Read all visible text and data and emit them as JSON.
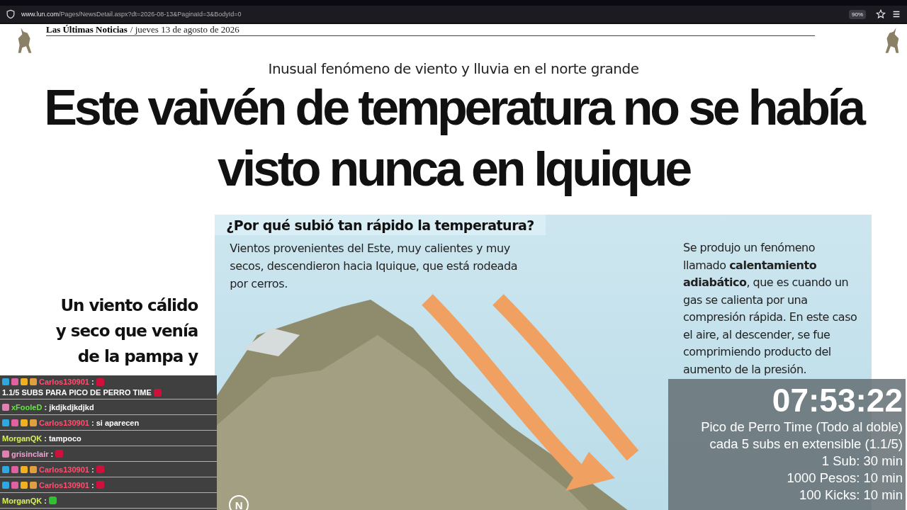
{
  "browser": {
    "url_host": "www.lun.com",
    "url_path": "/Pages/NewsDetail.aspx?dt=2026-08-13&PaginaId=3&BodyId=0",
    "zoom": "90%"
  },
  "newspaper": {
    "name": "Las Últimas Noticias",
    "date": "/ jueves 13 de agosto de 2026"
  },
  "article": {
    "kicker": "Inusual fenómeno de viento y lluvia en el norte grande",
    "headline": [
      "Este vaivén de temperatura no se había",
      "visto nunca en Iquique"
    ],
    "lead": [
      "Un viento cálido",
      "y seco que venía",
      "de la pampa y"
    ],
    "infographic": {
      "title": "¿Por qué subió tan rápido la temperatura?",
      "left_text": "Vientos provenientes del Este, muy calientes y muy secos, descendieron hacia Iquique, que está rodeada por cerros.",
      "right_text": "Se produjo un fenómeno llamado **calentamiento adiabático**, que es cuando un gas se calienta por una compresión rápida. En este caso el aire, al descender, se fue comprimiendo producto del aumento de la presión.",
      "compass": "N"
    }
  },
  "chat": [
    {
      "kind": "full",
      "user": "Carlos130901",
      "color": "#ff5070",
      "parts": [
        {
          "kind": "text",
          "text": ":"
        },
        {
          "kind": "emote",
          "color": "#d0103a"
        },
        {
          "kind": "text",
          "text": "1.1/5 SUBS PARA PICO DE PERRO TIME"
        },
        {
          "kind": "emote",
          "color": "#d0103a"
        }
      ]
    },
    {
      "kind": "sub",
      "user": "xFooleD",
      "color": "#5fe83a",
      "parts": [
        {
          "kind": "text",
          "text": ": jkdjkdjkdjkd"
        }
      ]
    },
    {
      "kind": "full",
      "user": "Carlos130901",
      "color": "#ff5070",
      "parts": [
        {
          "kind": "text",
          "text": ": si aparecen"
        }
      ]
    },
    {
      "kind": "none",
      "user": "MorganQK",
      "color": "#d8f060",
      "parts": [
        {
          "kind": "text",
          "text": ": tampoco"
        }
      ]
    },
    {
      "kind": "sub",
      "user": "grisinclair",
      "color": "#f0a0d0",
      "parts": [
        {
          "kind": "text",
          "text": ":"
        },
        {
          "kind": "emote",
          "color": "#d0103a"
        }
      ]
    },
    {
      "kind": "full",
      "user": "Carlos130901",
      "color": "#ff5070",
      "parts": [
        {
          "kind": "text",
          "text": ":"
        },
        {
          "kind": "emote",
          "color": "#d0103a"
        }
      ]
    },
    {
      "kind": "full",
      "user": "Carlos130901",
      "color": "#ff5070",
      "parts": [
        {
          "kind": "text",
          "text": ":"
        },
        {
          "kind": "emote",
          "color": "#d0103a"
        }
      ]
    },
    {
      "kind": "none",
      "user": "MorganQK",
      "color": "#d8f060",
      "parts": [
        {
          "kind": "text",
          "text": ":"
        },
        {
          "kind": "emote",
          "color": "#30c030"
        }
      ]
    }
  ],
  "timer": {
    "time": "07:53:22",
    "lines": [
      "Pico de Perro Time (Todo al doble)",
      "cada 5 subs en extensible (1.1/5)",
      "1 Sub: 30 min",
      "1000 Pesos: 10 min",
      "100 Kicks: 10 min"
    ]
  }
}
